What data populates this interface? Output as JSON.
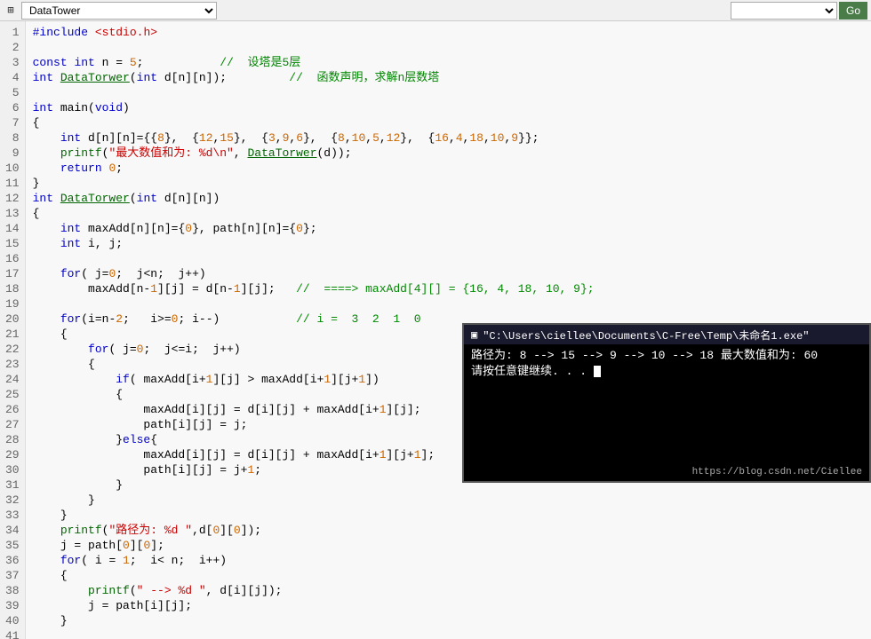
{
  "titlebar": {
    "icon": "⊞",
    "filename": "DataTower",
    "go_label": "Go",
    "dropdown2_value": ""
  },
  "editor": {
    "lines": [
      {
        "num": 1,
        "code": "#include <stdio.h>"
      },
      {
        "num": 2,
        "code": ""
      },
      {
        "num": 3,
        "code": "const int n = 5;           //  设塔是5层"
      },
      {
        "num": 4,
        "code": "int DataTorwer(int d[n][n]);         //  函数声明，求解n层数塔"
      },
      {
        "num": 5,
        "code": ""
      },
      {
        "num": 6,
        "code": "int main(void)"
      },
      {
        "num": 7,
        "code": "{"
      },
      {
        "num": 8,
        "code": "    int d[n][n]={{8},  {12,15},  {3,9,6},  {8,10,5,12},  {16,4,18,10,9}};"
      },
      {
        "num": 9,
        "code": "    printf(\"最大数值和为: %d\\n\", DataTorwer(d));"
      },
      {
        "num": 10,
        "code": "    return 0;"
      },
      {
        "num": 11,
        "code": "}"
      },
      {
        "num": 12,
        "code": "int DataTorwer(int d[n][n])"
      },
      {
        "num": 13,
        "code": "{"
      },
      {
        "num": 14,
        "code": "    int maxAdd[n][n]={0}, path[n][n]={0};"
      },
      {
        "num": 15,
        "code": "    int i, j;"
      },
      {
        "num": 16,
        "code": ""
      },
      {
        "num": 17,
        "code": "    for( j=0;  j<n;  j++)"
      },
      {
        "num": 18,
        "code": "        maxAdd[n-1][j] = d[n-1][j];   //  ====> maxAdd[4][] = {16, 4, 18, 10, 9};"
      },
      {
        "num": 19,
        "code": ""
      },
      {
        "num": 20,
        "code": "    for(i=n-2;   i>=0; i--)           // i =  3  2  1  0"
      },
      {
        "num": 21,
        "code": "    {"
      },
      {
        "num": 22,
        "code": "        for( j=0;  j<=i;  j++)"
      },
      {
        "num": 23,
        "code": "        {"
      },
      {
        "num": 24,
        "code": "            if( maxAdd[i+1][j] > maxAdd[i+1][j+1])"
      },
      {
        "num": 25,
        "code": "            {"
      },
      {
        "num": 26,
        "code": "                maxAdd[i][j] = d[i][j] + maxAdd[i+1][j];"
      },
      {
        "num": 27,
        "code": "                path[i][j] = j;"
      },
      {
        "num": 28,
        "code": "            }else{"
      },
      {
        "num": 29,
        "code": "                maxAdd[i][j] = d[i][j] + maxAdd[i+1][j+1];"
      },
      {
        "num": 30,
        "code": "                path[i][j] = j+1;"
      },
      {
        "num": 31,
        "code": "            }"
      },
      {
        "num": 32,
        "code": "        }"
      },
      {
        "num": 33,
        "code": "    }"
      },
      {
        "num": 34,
        "code": "    printf(\"路径为: %d \",d[0][0]);"
      },
      {
        "num": 35,
        "code": "    j = path[0][0];"
      },
      {
        "num": 36,
        "code": "    for( i = 1;  i< n;  i++)"
      },
      {
        "num": 37,
        "code": "    {"
      },
      {
        "num": 38,
        "code": "        printf(\" --> %d \", d[i][j]);"
      },
      {
        "num": 39,
        "code": "        j = path[i][j];"
      },
      {
        "num": 40,
        "code": "    }"
      },
      {
        "num": 41,
        "code": ""
      }
    ]
  },
  "console": {
    "title": "\"C:\\Users\\ciellee\\Documents\\C-Free\\Temp\\未命名1.exe\"",
    "icon": "▣",
    "line1": "路径为: 8  --> 15  --> 9  --> 10  --> 18 最大数值和为: 60 ",
    "line2": "请按任意键继续. . . ",
    "watermark": "https://blog.csdn.net/Ciellee"
  }
}
